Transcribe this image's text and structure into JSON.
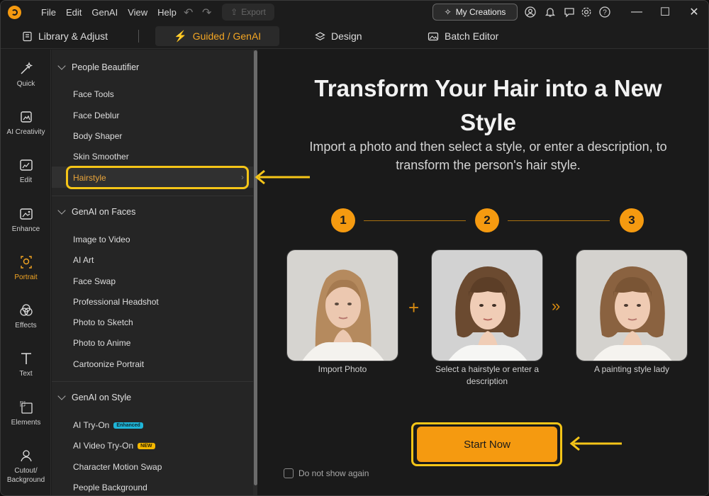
{
  "menu": {
    "file": "File",
    "edit": "Edit",
    "genai": "GenAI",
    "view": "View",
    "help": "Help",
    "export": "Export",
    "my_creations": "My Creations"
  },
  "tabs": [
    {
      "label": "Library & Adjust"
    },
    {
      "label": "Guided / GenAI"
    },
    {
      "label": "Design"
    },
    {
      "label": "Batch Editor"
    }
  ],
  "rail": [
    {
      "label": "Quick"
    },
    {
      "label": "AI Creativity"
    },
    {
      "label": "Edit"
    },
    {
      "label": "Enhance"
    },
    {
      "label": "Portrait"
    },
    {
      "label": "Effects"
    },
    {
      "label": "Text"
    },
    {
      "label": "Elements"
    },
    {
      "label": "Cutout/\nBackground"
    }
  ],
  "sections": {
    "people_beautifier": {
      "title": "People Beautifier",
      "items": [
        "Face Tools",
        "Face Deblur",
        "Body Shaper",
        "Skin Smoother",
        "Hairstyle"
      ]
    },
    "genai_faces": {
      "title": "GenAI on Faces",
      "items": [
        "Image to Video",
        "AI Art",
        "Face Swap",
        "Professional Headshot",
        "Photo to Sketch",
        "Photo to Anime",
        "Cartoonize Portrait"
      ]
    },
    "genai_style": {
      "title": "GenAI on Style",
      "items": [
        "AI Try-On",
        "AI Video Try-On",
        "Character Motion Swap",
        "People Background"
      ],
      "badges": {
        "enhanced": "Enhanced",
        "new": "NEW"
      }
    }
  },
  "main": {
    "title": "Transform Your Hair into a New Style",
    "subtitle": "Import a photo and then select a style, or enter a description, to transform the person's hair style.",
    "steps": [
      "1",
      "2",
      "3"
    ],
    "captions": [
      "Import Photo",
      "Select a hairstyle or enter a description",
      "A painting style lady"
    ],
    "start": "Start Now",
    "dont_show": "Do not show again"
  },
  "colors": {
    "accent": "#f59a10",
    "highlight_box": "#f5c518"
  }
}
